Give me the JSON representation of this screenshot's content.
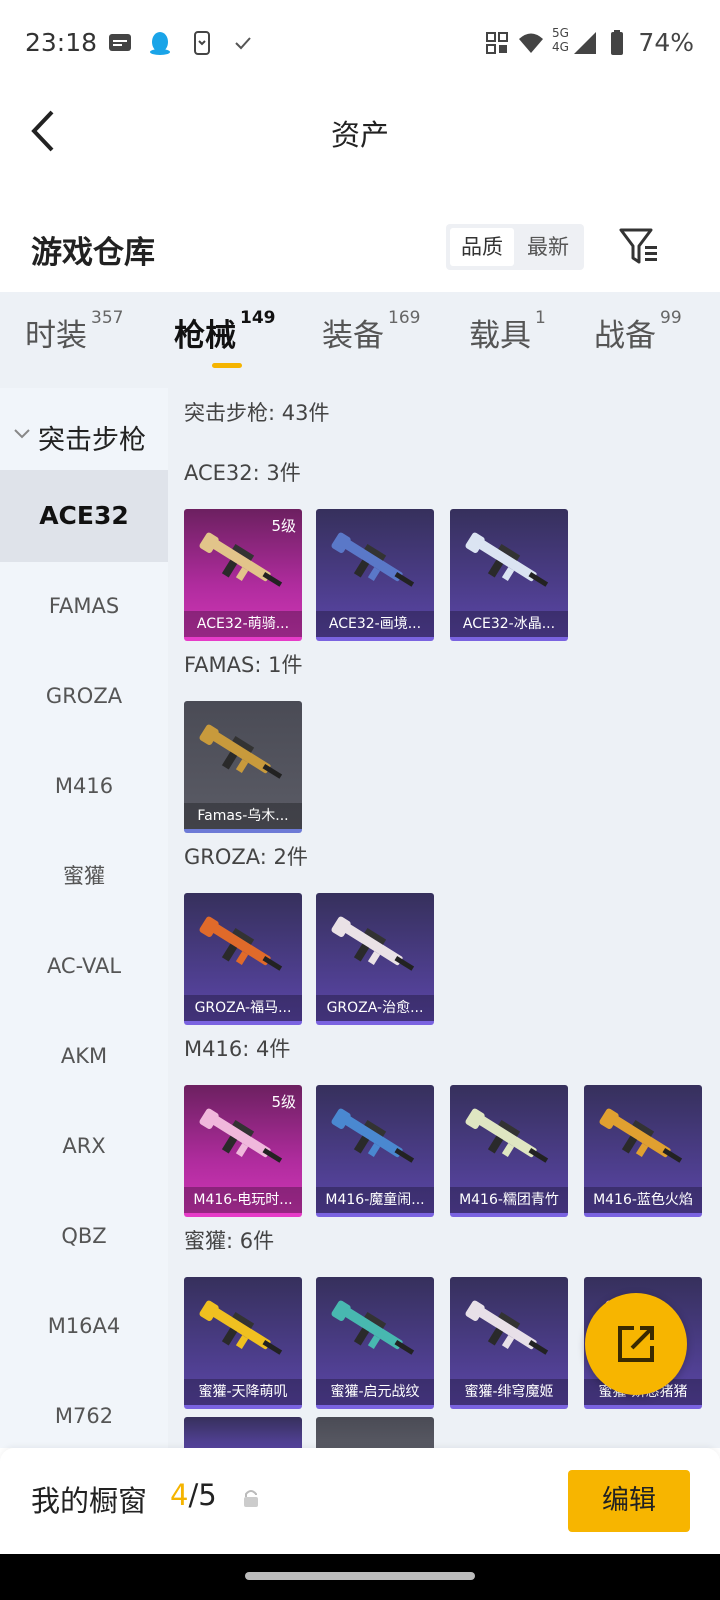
{
  "status_bar": {
    "time": "23:18",
    "battery_text": "74%",
    "network_top": "5G",
    "network_bottom": "4G",
    "icons": [
      "message-icon",
      "qq-icon",
      "phone-sync-icon",
      "check-icon",
      "qr-icon",
      "wifi-icon",
      "signal-icon",
      "battery-icon"
    ]
  },
  "nav": {
    "title": "资产",
    "back_icon": "back-arrow-icon"
  },
  "warehouse": {
    "title": "游戏仓库",
    "sort_options": [
      "品质",
      "最新"
    ],
    "selected_sort": "品质",
    "filter_icon": "filter-icon"
  },
  "tabs": [
    {
      "label": "时装",
      "count": "357"
    },
    {
      "label": "枪械",
      "count": "149"
    },
    {
      "label": "装备",
      "count": "169"
    },
    {
      "label": "载具",
      "count": "1"
    },
    {
      "label": "战备",
      "count": "99"
    }
  ],
  "active_tab": "枪械",
  "sidebar": {
    "category": "突击步枪",
    "items": [
      "ACE32",
      "FAMAS",
      "GROZA",
      "M416",
      "蜜獾",
      "AC-VAL",
      "AKM",
      "ARX",
      "QBZ",
      "M16A4",
      "M762"
    ],
    "selected": "ACE32"
  },
  "content": {
    "summary": "突击步枪: 43件",
    "sections": [
      {
        "title": "ACE32: 3件",
        "items": [
          {
            "name": "ACE32-萌骑...",
            "level": "5级",
            "rarity": "pink",
            "color": "#e2c48a"
          },
          {
            "name": "ACE32-画境...",
            "level": "",
            "rarity": "purple",
            "color": "#5a78c8"
          },
          {
            "name": "ACE32-冰晶...",
            "level": "",
            "rarity": "purple",
            "color": "#dbe4f2"
          }
        ]
      },
      {
        "title": "FAMAS: 1件",
        "items": [
          {
            "name": "Famas-乌木...",
            "level": "",
            "rarity": "gray",
            "color": "#c89a3c"
          }
        ]
      },
      {
        "title": "GROZA: 2件",
        "items": [
          {
            "name": "GROZA-福马...",
            "level": "",
            "rarity": "purple",
            "color": "#e06a2a"
          },
          {
            "name": "GROZA-治愈...",
            "level": "",
            "rarity": "purple",
            "color": "#eae2e6"
          }
        ]
      },
      {
        "title": "M416: 4件",
        "items": [
          {
            "name": "M416-电玩时...",
            "level": "5级",
            "rarity": "pink",
            "color": "#f0b8dc"
          },
          {
            "name": "M416-魔童闹...",
            "level": "",
            "rarity": "purple",
            "color": "#4a88d0"
          },
          {
            "name": "M416-糯团青竹",
            "level": "",
            "rarity": "purple",
            "color": "#dfe6c2"
          },
          {
            "name": "M416-蓝色火焰",
            "level": "",
            "rarity": "purple",
            "color": "#e0a030"
          }
        ]
      },
      {
        "title": "蜜獾: 6件",
        "items": [
          {
            "name": "蜜獾-天降萌叽",
            "level": "",
            "rarity": "purple",
            "color": "#f0c020"
          },
          {
            "name": "蜜獾-启元战纹",
            "level": "",
            "rarity": "purple",
            "color": "#48b8b0"
          },
          {
            "name": "蜜獾-绯穹魔姬",
            "level": "",
            "rarity": "purple",
            "color": "#e8e0e8"
          },
          {
            "name": "蜜獾-娇憨猪猪",
            "level": "",
            "rarity": "purple",
            "color": "#f0b8c8"
          }
        ]
      }
    ]
  },
  "fab_icon": "share-external-icon",
  "bottom_bar": {
    "label": "我的橱窗",
    "current": "4",
    "total": "/5",
    "lock_icon": "lock-icon",
    "edit_label": "编辑"
  },
  "colors": {
    "accent": "#f7b500",
    "pink_rarity": "#d036b6",
    "purple_rarity": "#5b46a8"
  }
}
